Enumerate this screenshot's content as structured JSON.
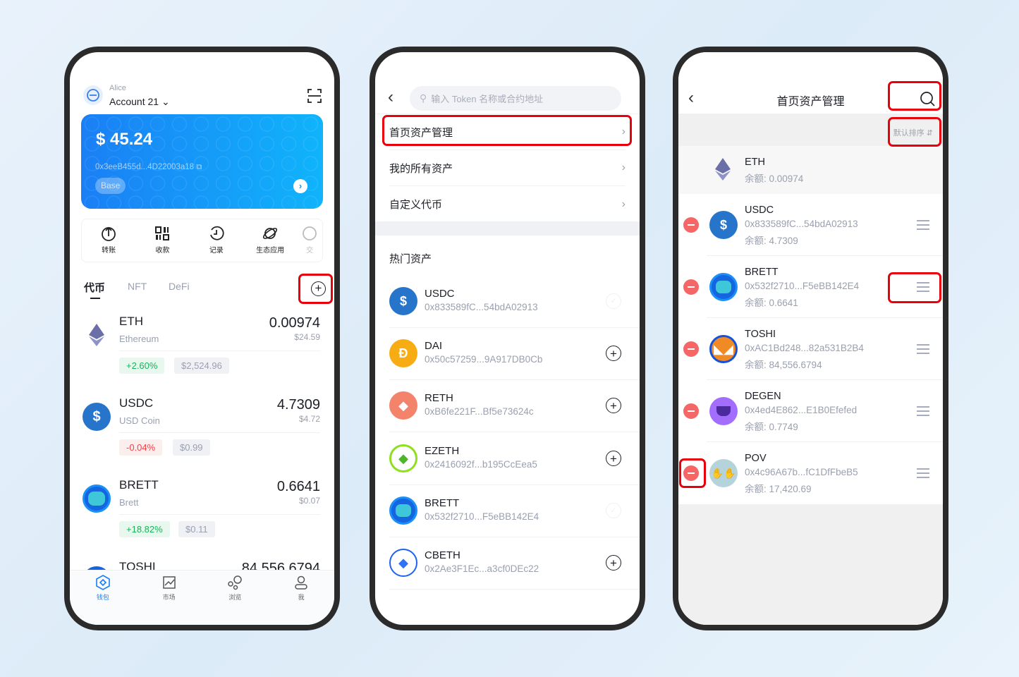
{
  "wallet": {
    "user": "Alice",
    "account": "Account 21",
    "balance": "$ 45.24",
    "address": "0x3eeB455d...4D22003a18",
    "network": "Base",
    "actions": [
      {
        "label": "转账",
        "icon": "send-icon"
      },
      {
        "label": "收款",
        "icon": "qr-icon"
      },
      {
        "label": "记录",
        "icon": "history-icon"
      },
      {
        "label": "生态应用",
        "icon": "planet-icon"
      },
      {
        "label": "交",
        "icon": "swap-icon"
      }
    ],
    "tabs": [
      "代币",
      "NFT",
      "DeFi"
    ],
    "tokens": [
      {
        "symbol": "ETH",
        "name": "Ethereum",
        "amount": "0.00974",
        "usd": "$24.59",
        "change": "+2.60%",
        "price": "$2,524.96",
        "up": true
      },
      {
        "symbol": "USDC",
        "name": "USD Coin",
        "amount": "4.7309",
        "usd": "$4.72",
        "change": "-0.04%",
        "price": "$0.99",
        "up": false
      },
      {
        "symbol": "BRETT",
        "name": "Brett",
        "amount": "0.6641",
        "usd": "$0.07",
        "change": "+18.82%",
        "price": "$0.11",
        "up": true
      },
      {
        "symbol": "TOSHI",
        "name": "",
        "amount": "84,556.6794",
        "usd": "",
        "change": "",
        "price": "",
        "up": true
      }
    ],
    "nav": [
      {
        "label": "钱包",
        "icon": "wallet-icon",
        "active": true
      },
      {
        "label": "市场",
        "icon": "market-icon"
      },
      {
        "label": "浏览",
        "icon": "browse-icon"
      },
      {
        "label": "我",
        "icon": "profile-icon"
      }
    ]
  },
  "search": {
    "placeholder": "输入 Token 名称或合约地址",
    "menu": [
      "首页资产管理",
      "我的所有资产",
      "自定义代币"
    ],
    "hot_title": "热门资产",
    "hot": [
      {
        "symbol": "USDC",
        "address": "0x833589fC...54bdA02913",
        "added": true
      },
      {
        "symbol": "DAI",
        "address": "0x50c57259...9A917DB0Cb",
        "added": false
      },
      {
        "symbol": "RETH",
        "address": "0xB6fe221F...Bf5e73624c",
        "added": false
      },
      {
        "symbol": "EZETH",
        "address": "0x2416092f...b195CcEea5",
        "added": false
      },
      {
        "symbol": "BRETT",
        "address": "0x532f2710...F5eBB142E4",
        "added": true
      },
      {
        "symbol": "CBETH",
        "address": "0x2Ae3F1Ec...a3cf0DEc22",
        "added": false
      }
    ]
  },
  "manage": {
    "title": "首页资产管理",
    "sort": "默认排序 ⇵",
    "eth": {
      "symbol": "ETH",
      "balance": "余额: 0.00974"
    },
    "tokens": [
      {
        "symbol": "USDC",
        "address": "0x833589fC...54bdA02913",
        "balance": "余额: 4.7309"
      },
      {
        "symbol": "BRETT",
        "address": "0x532f2710...F5eBB142E4",
        "balance": "余额: 0.6641"
      },
      {
        "symbol": "TOSHI",
        "address": "0xAC1Bd248...82a531B2B4",
        "balance": "余额: 84,556.6794"
      },
      {
        "symbol": "DEGEN",
        "address": "0x4ed4E862...E1B0Efefed",
        "balance": "余额: 0.7749"
      },
      {
        "symbol": "POV",
        "address": "0x4c96A67b...fC1DfFbeB5",
        "balance": "余额: 17,420.69"
      }
    ]
  },
  "colors": {
    "accent": "#1a7ff5",
    "highlight": "#e8000b",
    "up": "#16b35a",
    "down": "#f0434a",
    "remove": "#f56767"
  }
}
